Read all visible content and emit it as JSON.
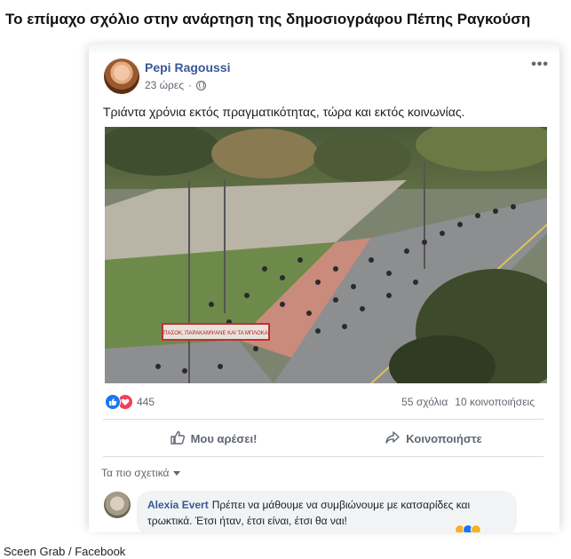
{
  "headline": "Το επίμαχο σχόλιο στην ανάρτηση της δημοσιογράφου Πέπης Ραγκούση",
  "post": {
    "author": "Pepi Ragoussi",
    "time": "23 ώρες",
    "more_icon": "•••",
    "text": "Τριάντα χρόνια εκτός πραγματικότητας, τώρα και εκτός κοινωνίας.",
    "photo_banner": "ΠΑΣΟΚ, ΠΑΡΑΚΑΜΨΑΝΕ ΚΑΙ ΤΑ ΜΠΛΟΚΑ",
    "reaction_count": "445",
    "comments": "55 σχόλια",
    "shares": "10 κοινοποιήσεις"
  },
  "actions": {
    "like": "Μου αρέσει!",
    "share": "Κοινοποιήστε"
  },
  "comments_section": {
    "sort_label": "Τα πιο σχετικά",
    "comment": {
      "author": "Alexia Evert",
      "text": "Πρέπει να μάθουμε να συμβιώνουμε με κατσαρίδες και τρωκτικά. Έτσι ήταν, έτσι είναι, έτσι θα ναι!"
    }
  },
  "credit": "Sceen Grab / Facebook",
  "colors": {
    "link_blue": "#385898",
    "like_blue": "#1877f2",
    "love_red": "#f33e58",
    "secondary_text": "#606770"
  }
}
